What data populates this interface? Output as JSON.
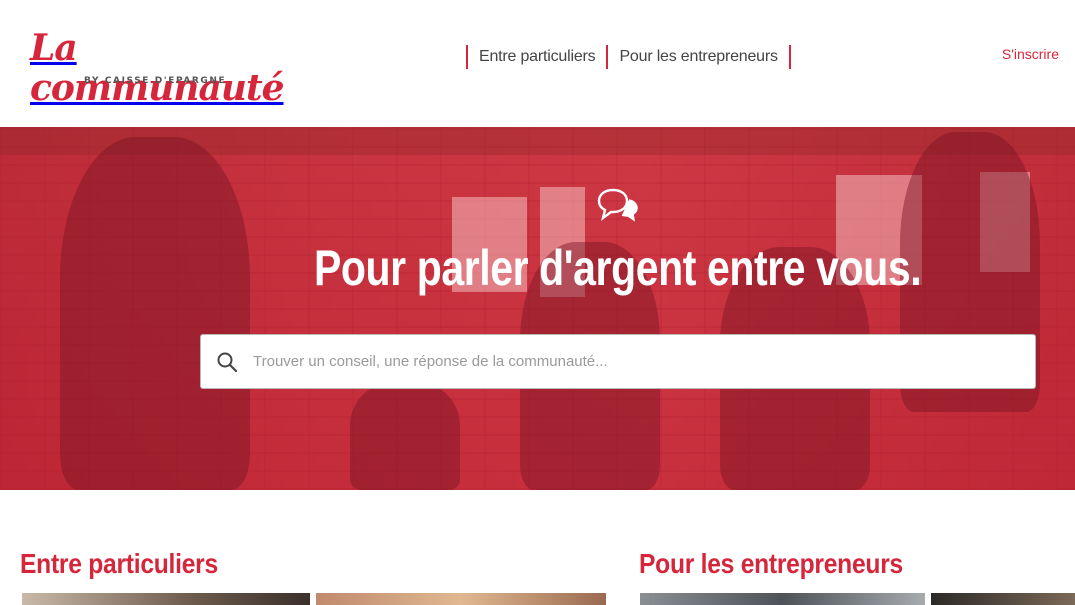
{
  "header": {
    "logo_text": "La communauté",
    "logo_sub": "BY CAISSE D'EPARGNE",
    "nav": [
      {
        "label": "Entre particuliers"
      },
      {
        "label": "Pour les entrepreneurs"
      }
    ],
    "signup_label": "S'inscrire"
  },
  "hero": {
    "title": "Pour parler d'argent entre vous.",
    "icon": "chat-bubbles-icon",
    "search": {
      "placeholder": "Trouver un conseil, une réponse de la communauté...",
      "value": "",
      "icon": "search-icon"
    }
  },
  "sections": [
    {
      "title": "Entre particuliers"
    },
    {
      "title": "Pour les entrepreneurs"
    }
  ],
  "colors": {
    "brand": "#d6263b",
    "hero_overlay": "#d6263b",
    "nav_text": "#444444"
  }
}
